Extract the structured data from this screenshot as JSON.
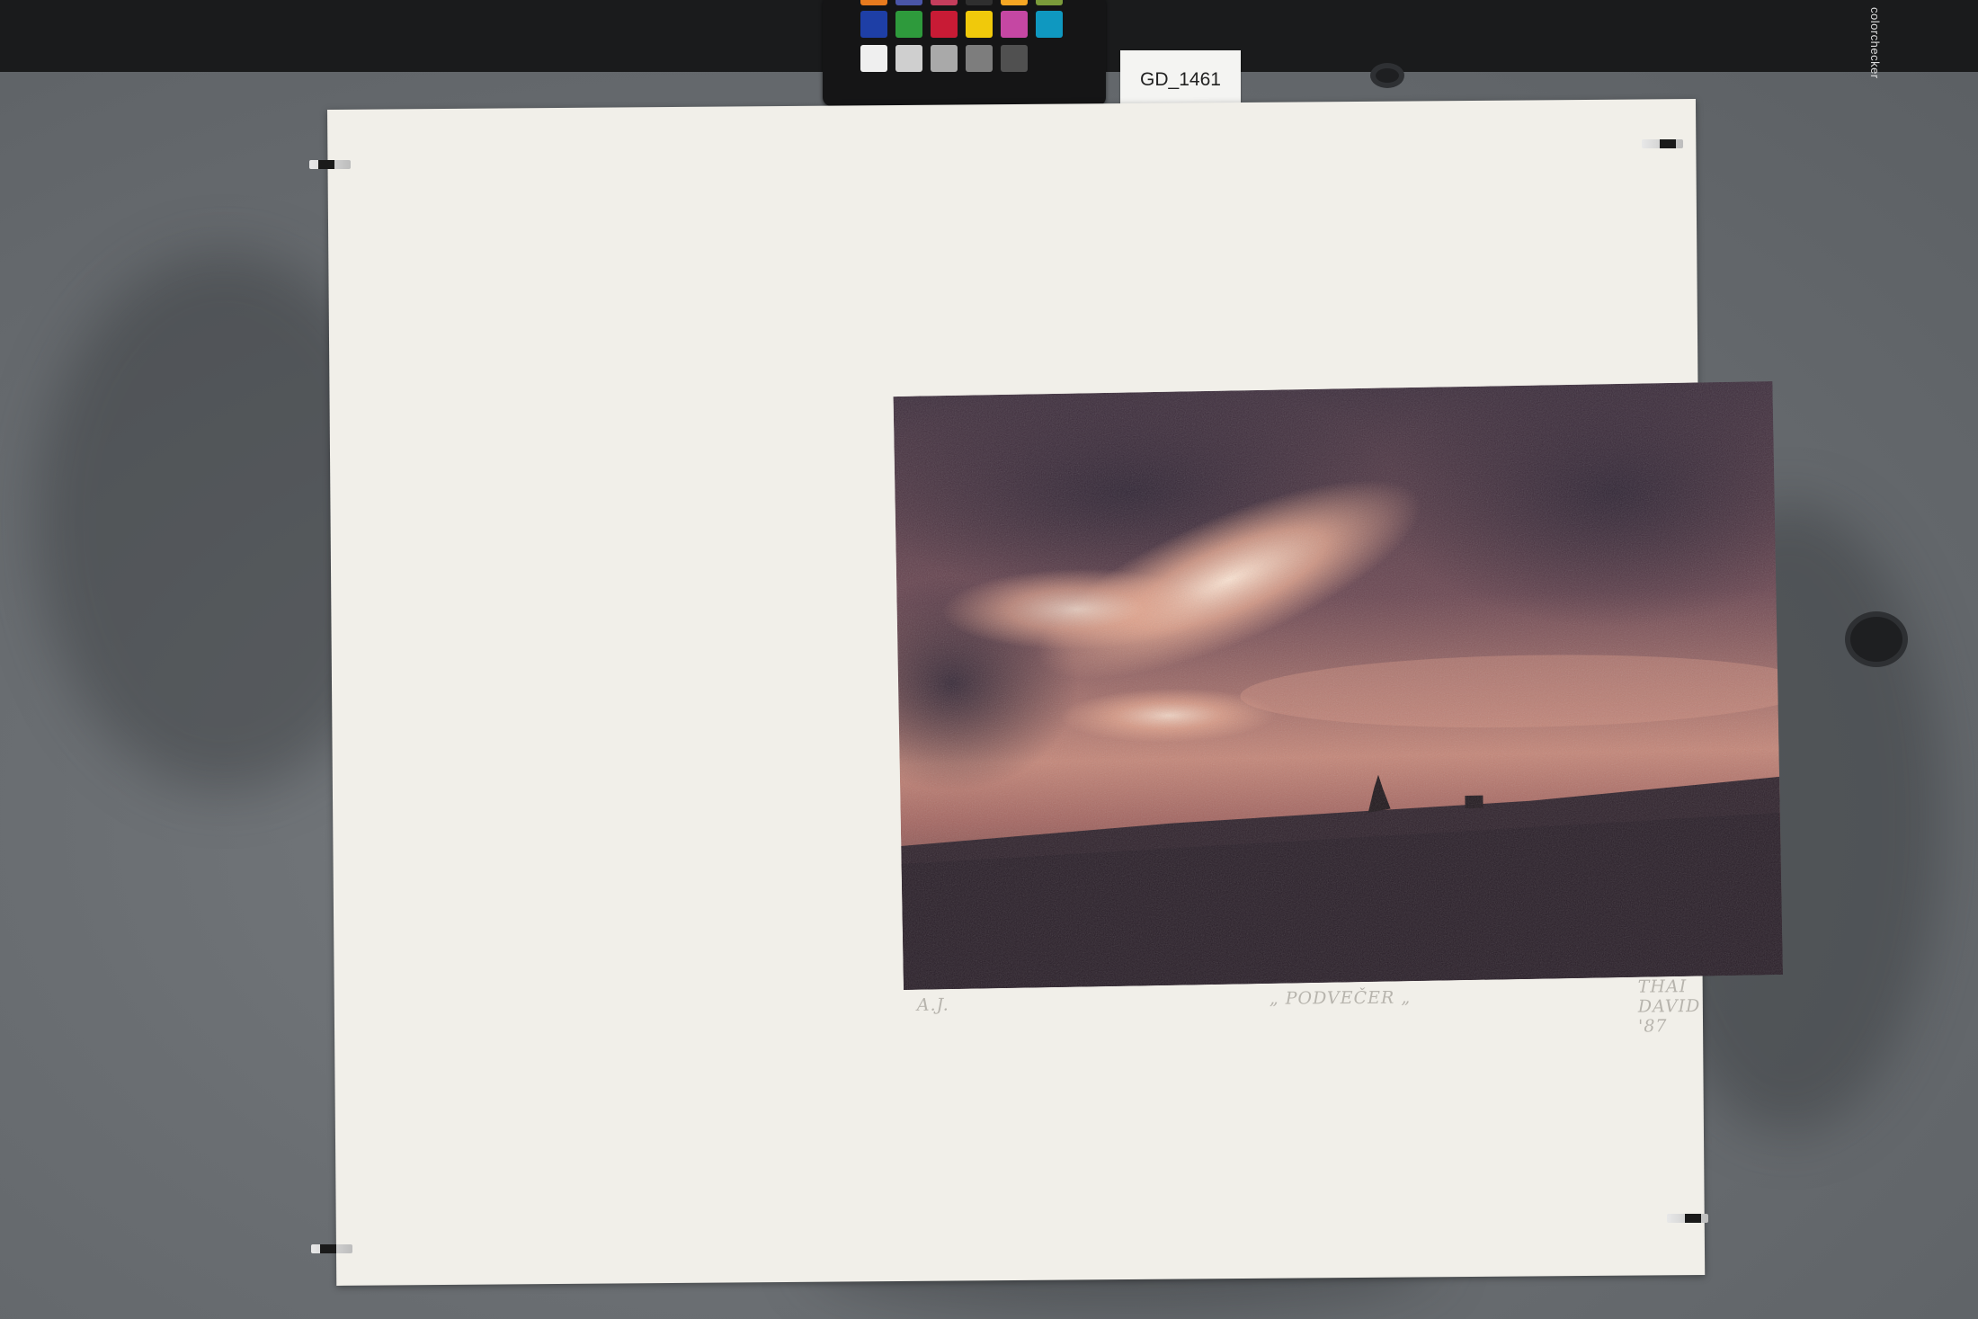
{
  "scene": {
    "label_tag": "GD_1461",
    "color_checker_brand": "colorchecker",
    "print_inscriptions": {
      "edition": "A.J.",
      "title": "„ PODVEČER „",
      "signature": "THAI DAVID '87"
    },
    "checker_colors": [
      "#1e3fa6",
      "#2e9a3c",
      "#c81b35",
      "#f0c90b",
      "#c547a3",
      "#0f98c0",
      "#efefef",
      "#cfcfcf",
      "#a9a9a9",
      "#7d7d7d",
      "#505050"
    ],
    "print_palette": {
      "sky_dark": "#3a2a38",
      "glow": "#f6c9b3",
      "horizon": "#c9897a",
      "ground": "#2c1f28"
    }
  }
}
